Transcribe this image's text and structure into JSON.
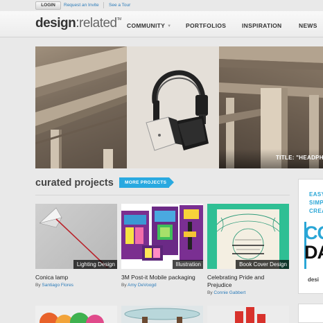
{
  "topbar": {
    "login_label": "LOGIN",
    "links": [
      "Request an Invite",
      "See a Tour"
    ]
  },
  "header": {
    "logo_bold": "design",
    "logo_colon": ":",
    "logo_light": "related",
    "logo_tm": "TM",
    "nav": [
      {
        "label": "COMMUNITY",
        "has_dropdown": true
      },
      {
        "label": "PORTFOLIOS"
      },
      {
        "label": "INSPIRATION"
      },
      {
        "label": "NEWS"
      }
    ]
  },
  "hero": {
    "caption": "TITLE: \"HEADPHO"
  },
  "curated": {
    "title": "curated projects",
    "more_label": "MORE PROJECTS",
    "projects": [
      {
        "tag": "Lighting Design",
        "title": "Conica lamp",
        "by": "By",
        "author": "Santiago Flores"
      },
      {
        "tag": "Illustration",
        "title": "3M Post-it Mobile packaging",
        "by": "By",
        "author": "Amy DeVoogd"
      },
      {
        "tag": "Book Cover Design",
        "title": "Celebrating Pride and Prejudice",
        "by": "By",
        "author": "Connie Gabbert"
      }
    ]
  },
  "ad": {
    "lines": [
      "EASY",
      "SIMP",
      "CREA"
    ],
    "big1": "CO",
    "big2": "DA",
    "foot": "desi"
  },
  "colors": {
    "accent": "#29a9e0",
    "link": "#2b7bb9",
    "page_bg": "#e9e9e9"
  }
}
